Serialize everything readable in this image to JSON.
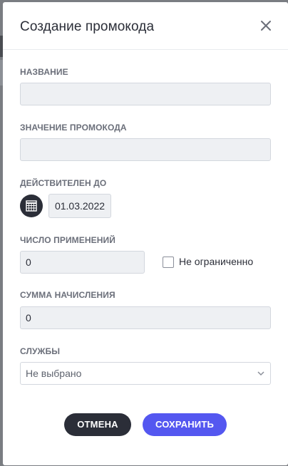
{
  "modal": {
    "title": "Создание промокода",
    "close_icon": "close-icon"
  },
  "fields": {
    "name": {
      "label": "НАЗВАНИЕ",
      "value": ""
    },
    "promo_value": {
      "label": "ЗНАЧЕНИЕ ПРОМОКОДА",
      "value": ""
    },
    "valid_until": {
      "label": "ДЕЙСТВИТЕЛЕН ДО",
      "value": "01.03.2022",
      "icon": "calendar-icon"
    },
    "uses_count": {
      "label": "ЧИСЛО ПРИМЕНЕНИЙ",
      "value": "0",
      "unlimited_label": "Не ограниченно",
      "unlimited_checked": false
    },
    "credit_amount": {
      "label": "СУММА НАЧИСЛЕНИЯ",
      "value": "0"
    },
    "services": {
      "label": "СЛУЖБЫ",
      "selected": "Не выбрано",
      "icon": "chevron-down-icon"
    }
  },
  "actions": {
    "cancel_label": "ОТМЕНА",
    "save_label": "СОХРАНИТЬ"
  },
  "colors": {
    "primary": "#5457f0",
    "dark": "#2b2e38",
    "input_bg": "#eef0f3"
  }
}
